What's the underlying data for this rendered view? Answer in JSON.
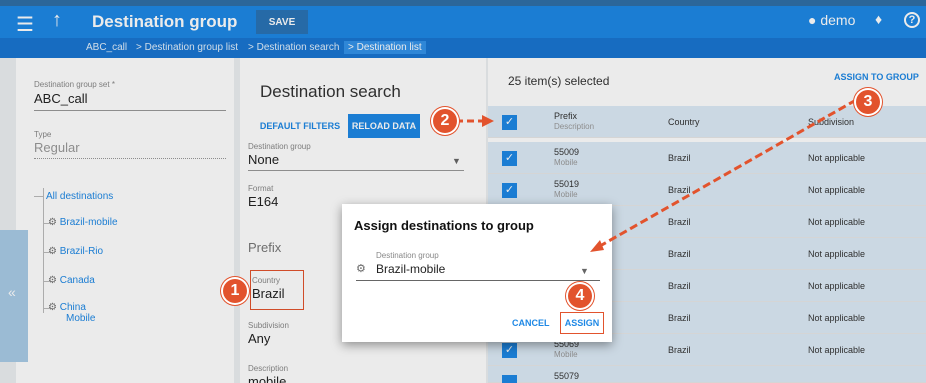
{
  "header": {
    "menu_icon": "menu-icon",
    "title": "Destination group",
    "save_label": "SAVE",
    "user": "demo",
    "help": "?"
  },
  "breadcrumb": [
    "ABC_call",
    "> Destination group list",
    "> Destination search",
    "> Destination list"
  ],
  "left": {
    "set_label": "Destination group set *",
    "set_value": "ABC_call",
    "type_label": "Type",
    "type_value": "Regular",
    "all_destinations": "All destinations",
    "items": [
      {
        "label": "Brazil-mobile",
        "sub": ""
      },
      {
        "label": "Brazil-Rio",
        "sub": ""
      },
      {
        "label": "Canada",
        "sub": ""
      },
      {
        "label": "China",
        "sub": "Mobile"
      }
    ],
    "collapse": "«"
  },
  "search": {
    "title": "Destination search",
    "default_filters": "DEFAULT FILTERS",
    "reload_data": "RELOAD DATA",
    "group_label": "Destination group",
    "group_value": "None",
    "format_label": "Format",
    "format_value": "E164",
    "prefix_label": "Prefix",
    "country_label": "Country",
    "country_value": "Brazil",
    "subdivision_label": "Subdivision",
    "subdivision_value": "Any",
    "description_label": "Description",
    "description_value": "mobile"
  },
  "list": {
    "selected_text": "25 item(s) selected",
    "assign_to_group": "ASSIGN TO GROUP",
    "col_prefix": "Prefix",
    "col_description": "Description",
    "col_country": "Country",
    "col_subdivision": "Subdivision",
    "rows": [
      {
        "prefix": "55009",
        "desc": "Mobile",
        "country": "Brazil",
        "subdivision": "Not applicable"
      },
      {
        "prefix": "55019",
        "desc": "Mobile",
        "country": "Brazil",
        "subdivision": "Not applicable"
      },
      {
        "prefix": "",
        "desc": "",
        "country": "Brazil",
        "subdivision": "Not applicable"
      },
      {
        "prefix": "",
        "desc": "",
        "country": "Brazil",
        "subdivision": "Not applicable"
      },
      {
        "prefix": "",
        "desc": "",
        "country": "Brazil",
        "subdivision": "Not applicable"
      },
      {
        "prefix": "",
        "desc": "",
        "country": "Brazil",
        "subdivision": "Not applicable"
      },
      {
        "prefix": "55069",
        "desc": "Mobile",
        "country": "Brazil",
        "subdivision": "Not applicable"
      },
      {
        "prefix": "55079",
        "desc": "",
        "country": "",
        "subdivision": ""
      }
    ]
  },
  "dialog": {
    "title": "Assign destinations to group",
    "group_label": "Destination group",
    "group_value": "Brazil-mobile",
    "cancel": "CANCEL",
    "assign": "ASSIGN"
  },
  "callouts": [
    "1",
    "2",
    "3",
    "4"
  ],
  "colors": {
    "primary": "#1e88e5",
    "callout": "#e2532d"
  }
}
